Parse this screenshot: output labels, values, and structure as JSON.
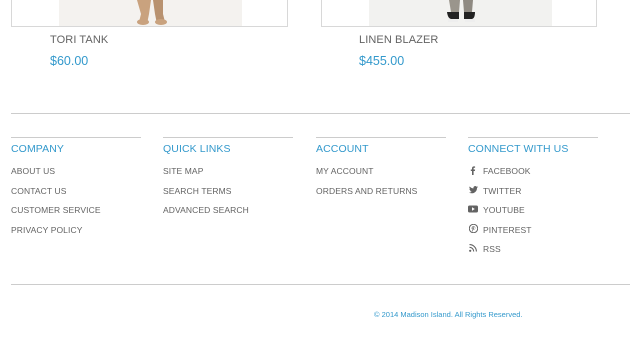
{
  "products": [
    {
      "name": "TORI TANK",
      "price": "$60.00"
    },
    {
      "name": "LINEN BLAZER",
      "price": "$455.00"
    }
  ],
  "footer": {
    "columns": [
      {
        "title": "COMPANY",
        "links": [
          "ABOUT US",
          "CONTACT US",
          "CUSTOMER SERVICE",
          "PRIVACY POLICY"
        ]
      },
      {
        "title": "QUICK LINKS",
        "links": [
          "SITE MAP",
          "SEARCH TERMS",
          "ADVANCED SEARCH"
        ]
      },
      {
        "title": "ACCOUNT",
        "links": [
          "MY ACCOUNT",
          "ORDERS AND RETURNS"
        ]
      },
      {
        "title": "CONNECT WITH US",
        "links": [
          {
            "label": "FACEBOOK",
            "icon": "facebook-icon"
          },
          {
            "label": "TWITTER",
            "icon": "twitter-icon"
          },
          {
            "label": "YOUTUBE",
            "icon": "youtube-icon"
          },
          {
            "label": "PINTEREST",
            "icon": "pinterest-icon"
          },
          {
            "label": "RSS",
            "icon": "rss-icon"
          }
        ]
      }
    ],
    "copyright": "© 2014 Madison Island. All Rights Reserved."
  },
  "colors": {
    "accent": "#3399cc",
    "text": "#636363",
    "rule": "#cccccc"
  }
}
